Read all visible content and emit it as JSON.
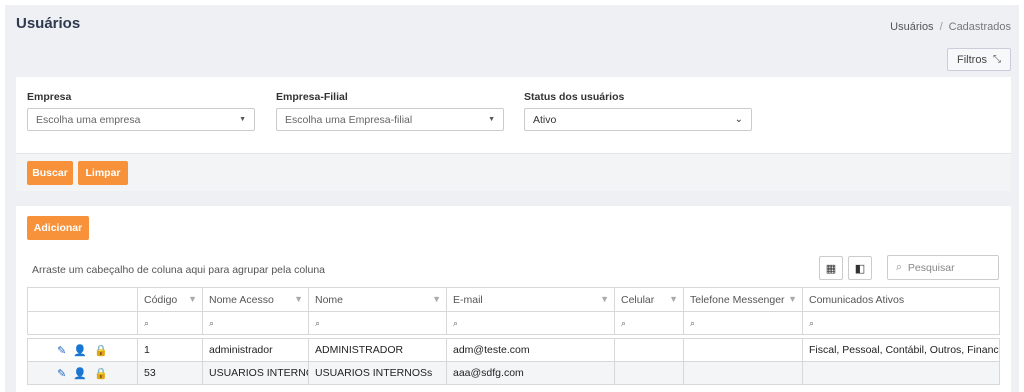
{
  "header": {
    "title": "Usuários",
    "breadcrumb": [
      "Usuários",
      "/",
      "Cadastrados"
    ],
    "filters_button": "Filtros"
  },
  "filters": {
    "empresa": {
      "label": "Empresa",
      "placeholder": "Escolha uma empresa"
    },
    "filial": {
      "label": "Empresa-Filial",
      "placeholder": "Escolha uma Empresa-filial"
    },
    "status": {
      "label": "Status dos usuários",
      "value": "Ativo"
    }
  },
  "actions": {
    "search": "Buscar",
    "clear": "Limpar"
  },
  "grid": {
    "add_button": "Adicionar",
    "group_hint": "Arraste um cabeçalho de coluna aqui para agrupar pela coluna",
    "search_placeholder": "Pesquisar",
    "columns": [
      "",
      "Código",
      "Nome Acesso",
      "Nome",
      "E-mail",
      "Celular",
      "Telefone Messenger",
      "Comunicados Ativos"
    ],
    "rows": [
      {
        "code": "1",
        "login": "administrador",
        "name": "ADMINISTRADOR",
        "email": "adm@teste.com",
        "phone": "",
        "messenger": "",
        "notices": "Fiscal, Pessoal, Contábil, Outros, Financeiro, S"
      },
      {
        "code": "53",
        "login": "USUARIOS INTERNOS",
        "name": "USUARIOS INTERNOSs",
        "email": "aaa@sdfg.com",
        "phone": "",
        "messenger": "",
        "notices": ""
      }
    ]
  },
  "icons": {
    "edit": "pencil-icon",
    "user_remove": "user-times-icon",
    "lock": "lock-icon",
    "filter": "filter-icon",
    "search": "search-icon"
  },
  "colors": {
    "accent": "#f7913a",
    "action_icon": "#1f66c1",
    "title": "#2e3a4f"
  }
}
